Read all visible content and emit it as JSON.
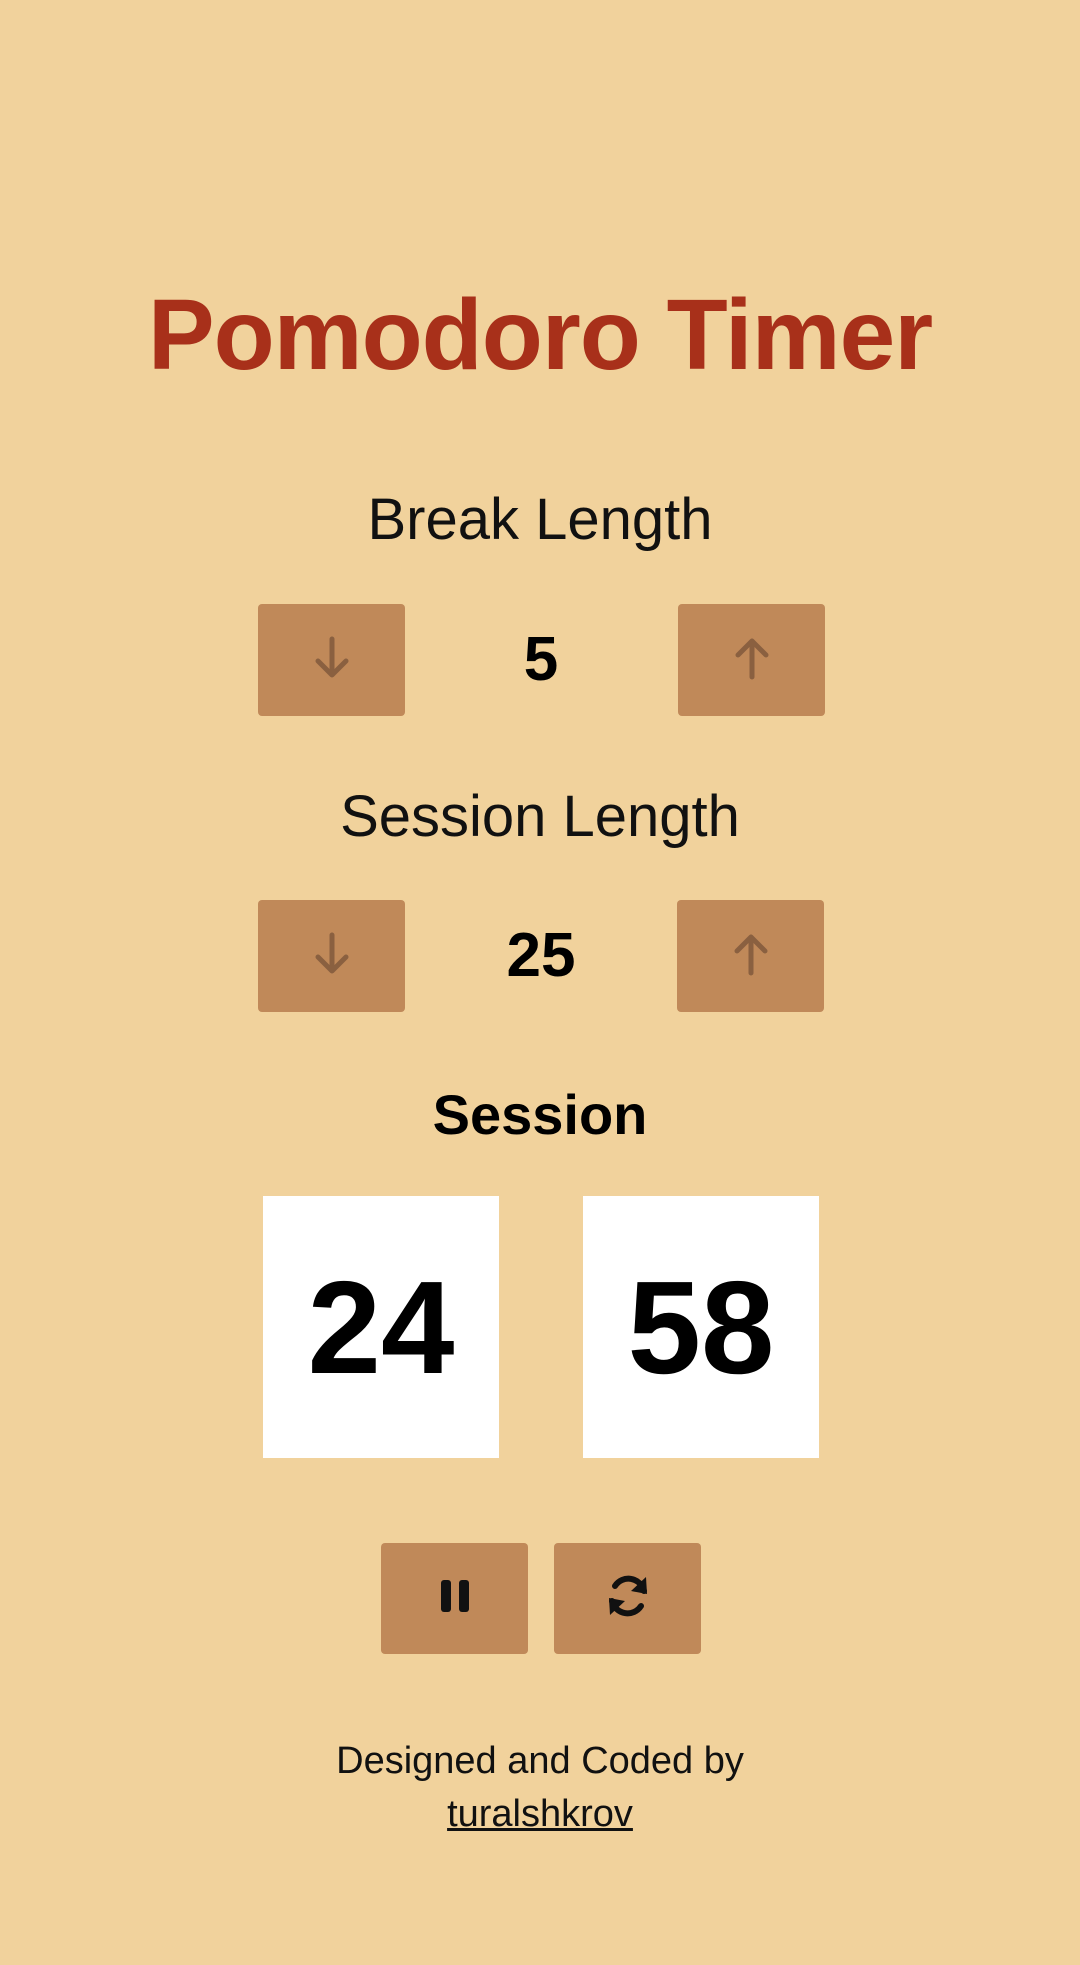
{
  "app": {
    "title": "Pomodoro Timer"
  },
  "break": {
    "label": "Break Length",
    "value": "5",
    "decrement_icon": "arrow-down-icon",
    "increment_icon": "arrow-up-icon"
  },
  "session": {
    "label": "Session Length",
    "value": "25",
    "decrement_icon": "arrow-down-icon",
    "increment_icon": "arrow-up-icon"
  },
  "timer": {
    "status": "Session",
    "minutes": "24",
    "seconds": "58"
  },
  "controls": {
    "pause_icon": "pause-icon",
    "reset_icon": "refresh-icon"
  },
  "footer": {
    "text": "Designed and Coded by",
    "author": "turalshkrov"
  },
  "colors": {
    "background": "#f1d29c",
    "title": "#a8301a",
    "button": "#c08959",
    "arrow": "#8a6040",
    "timer_box": "#ffffff"
  }
}
